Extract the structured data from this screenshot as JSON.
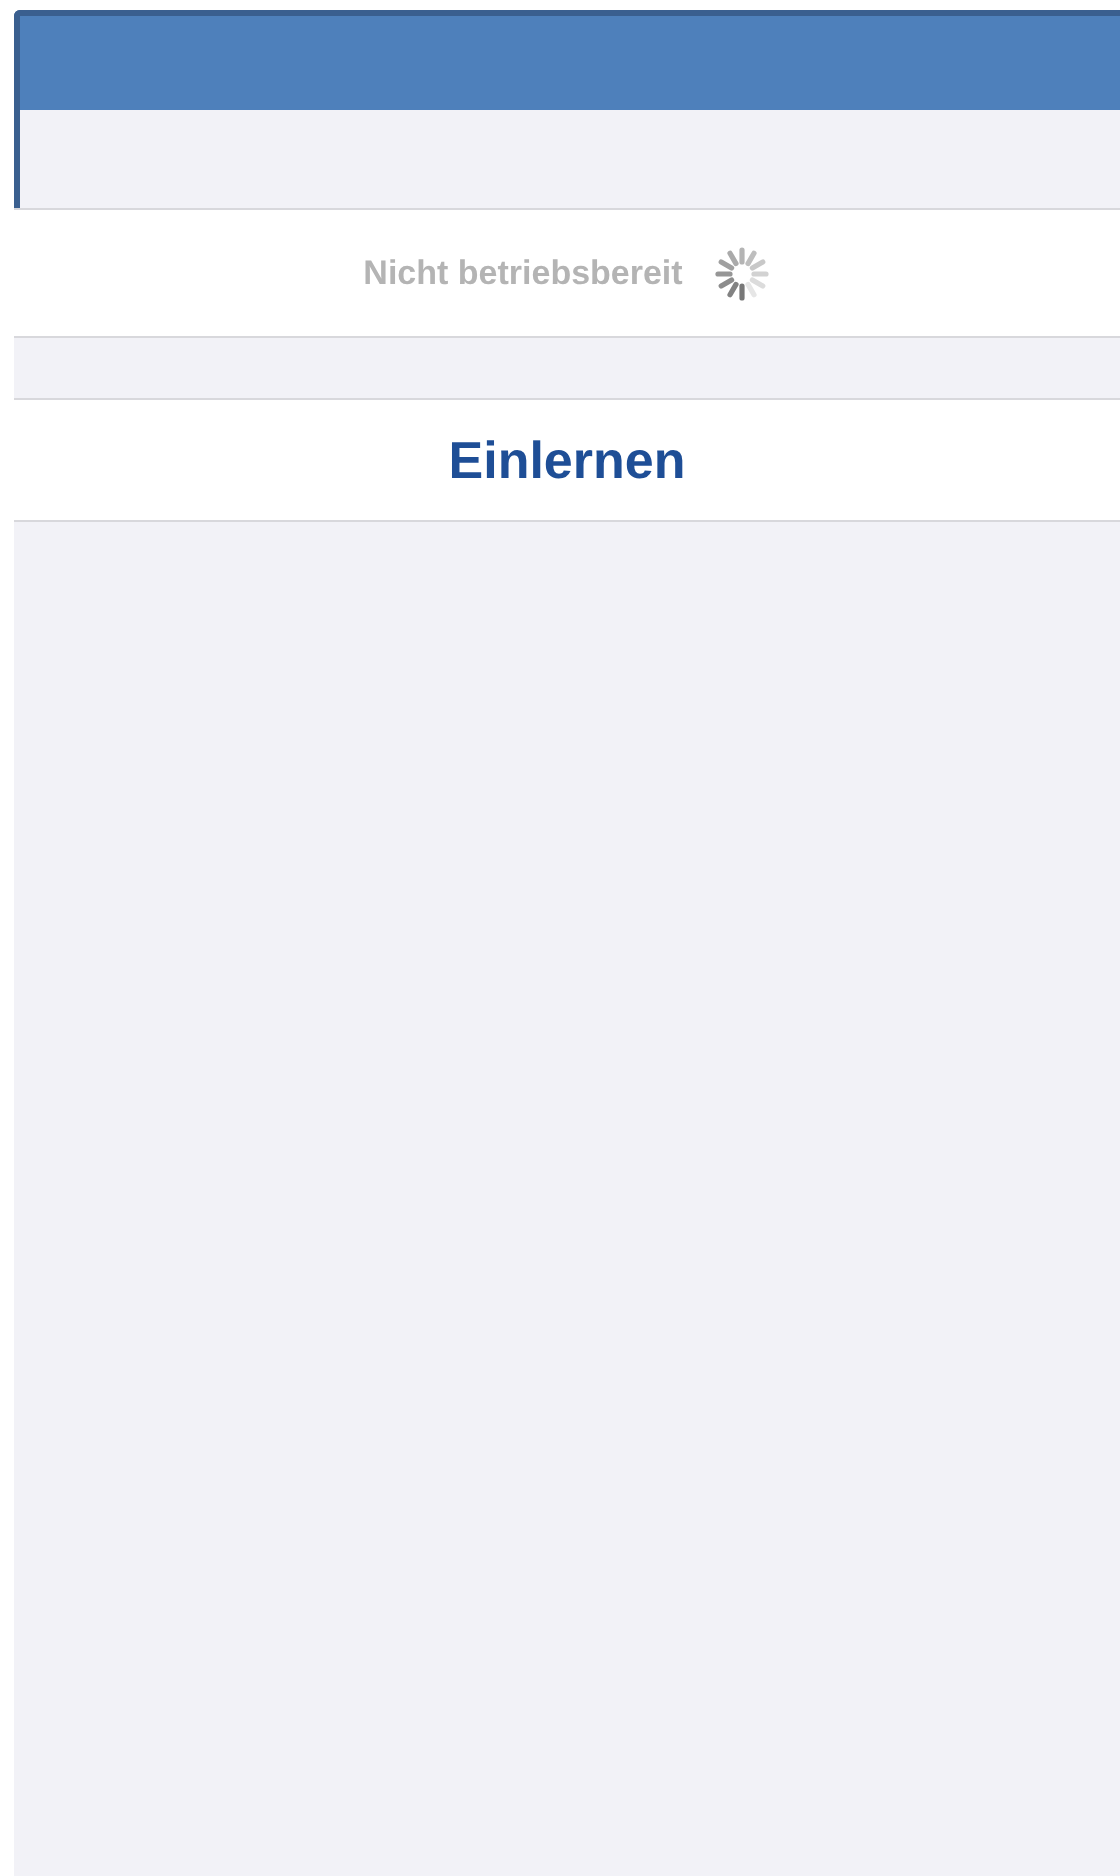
{
  "status": {
    "text": "Nicht betriebsbereit",
    "loading": true
  },
  "action": {
    "label": "Einlernen"
  }
}
